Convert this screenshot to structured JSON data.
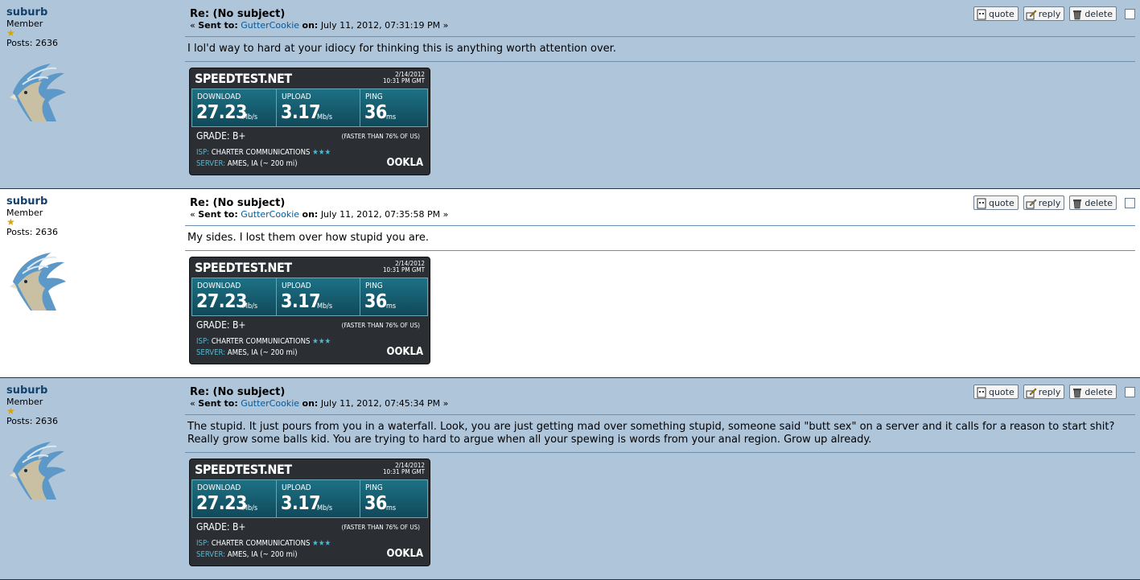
{
  "messages": [
    {
      "poster": {
        "name": "suburb",
        "rank": "Member",
        "posts": "Posts: 2636"
      },
      "subject": "Re: (No subject)",
      "sent_label": "Sent to:",
      "recipient": "GutterCookie",
      "on_label": "on:",
      "date": "July 11, 2012, 07:31:19 PM",
      "text": "I lol'd way to hard at your idiocy for thinking this is anything worth attention over.",
      "style": "alt"
    },
    {
      "poster": {
        "name": "suburb",
        "rank": "Member",
        "posts": "Posts: 2636"
      },
      "subject": "Re: (No subject)",
      "sent_label": "Sent to:",
      "recipient": "GutterCookie",
      "on_label": "on:",
      "date": "July 11, 2012, 07:35:58 PM",
      "text": "My sides.  I lost them over how stupid you are.",
      "style": "white"
    },
    {
      "poster": {
        "name": "suburb",
        "rank": "Member",
        "posts": "Posts: 2636"
      },
      "subject": "Re: (No subject)",
      "sent_label": "Sent to:",
      "recipient": "GutterCookie",
      "on_label": "on:",
      "date": "July 11, 2012, 07:45:34 PM",
      "text": "The stupid.  It just pours from you in a waterfall.  Look, you are just getting mad over something stupid, someone said \"butt sex\" on a server and it calls for a reason to start shit?  Really grow some balls kid.  You are trying to hard to argue when all your spewing is words from your anal region.  Grow up already.",
      "style": "alt"
    }
  ],
  "actions": {
    "quote": "quote",
    "reply": "reply",
    "delete": "delete"
  },
  "speedtest": {
    "brand": "SPEEDTEST.NET",
    "date_line1": "2/14/2012",
    "date_line2": "10:31 PM GMT",
    "download_label": "DOWNLOAD",
    "download_value": "27.23",
    "download_unit": "Mb/s",
    "upload_label": "UPLOAD",
    "upload_value": "3.17",
    "upload_unit": "Mb/s",
    "ping_label": "PING",
    "ping_value": "36",
    "ping_unit": "ms",
    "grade": "GRADE: B+",
    "faster": "(FASTER THAN 76% OF US)",
    "isp_label": "ISP:",
    "isp_value": "CHARTER COMMUNICATIONS",
    "isp_stars": "★★★",
    "server_label": "SERVER:",
    "server_value": "AMES, IA (~ 200 mi)",
    "ookla": "OOKLA"
  },
  "colors": {
    "alt_bg": "#afc5da",
    "name": "#14416b",
    "link": "#005b9e"
  }
}
